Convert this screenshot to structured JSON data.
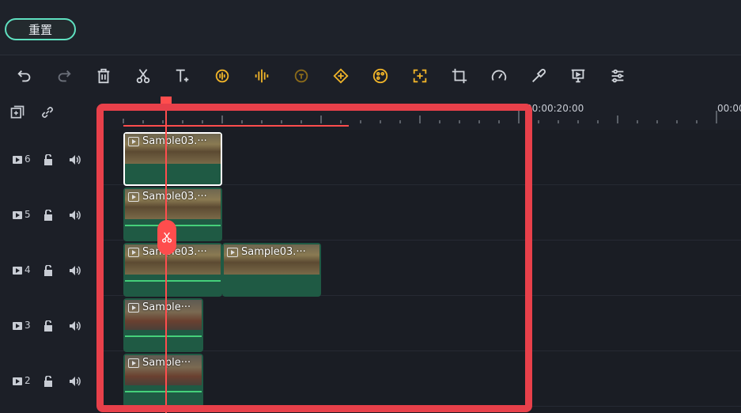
{
  "topbar": {
    "reset_label": "重置"
  },
  "toolbar": {
    "tools": [
      "undo-icon",
      "redo-icon",
      "delete-icon",
      "scissors-icon",
      "text-icon",
      "audio-icon",
      "audio-waveform-icon",
      "speech-icon",
      "keyframe-icon",
      "color-icon",
      "auto-reframe-icon",
      "crop-icon",
      "speed-icon",
      "eyedropper-icon",
      "present-icon",
      "adjust-icon"
    ]
  },
  "ruler": {
    "time1": "00:00:20:00",
    "time2": "00:00"
  },
  "tracks": [
    {
      "label": "6"
    },
    {
      "label": "5"
    },
    {
      "label": "4"
    },
    {
      "label": "3"
    },
    {
      "label": "2"
    }
  ],
  "clips": {
    "c6": "Sample03.···",
    "c5": "Sample03.···",
    "c4a": "Sample03.···",
    "c4b": "Sample03.···",
    "c3": "Sample···",
    "c2": "Sample···"
  },
  "colors": {
    "accent": "#5fe0c0",
    "highlight": "#e8404a",
    "playhead": "#ff4d4d",
    "clip": "#1f5a44"
  }
}
